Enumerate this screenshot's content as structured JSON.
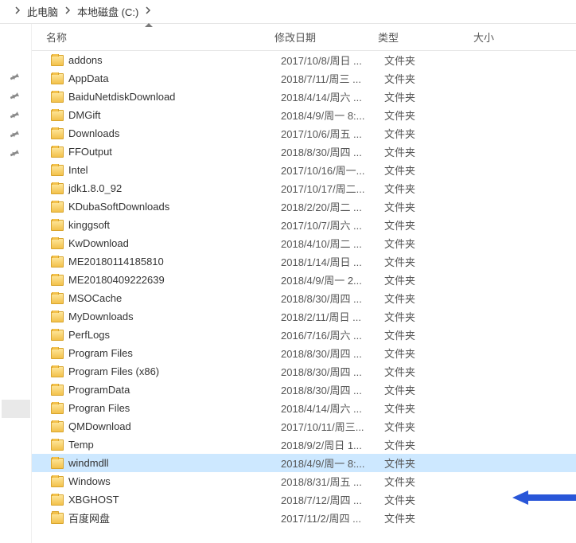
{
  "breadcrumb": {
    "items": [
      "此电脑",
      "本地磁盘 (C:)"
    ]
  },
  "columns": {
    "name": "名称",
    "date": "修改日期",
    "type": "类型",
    "size": "大小"
  },
  "type_folder": "文件夹",
  "selected_index": 22,
  "rows": [
    {
      "name": "addons",
      "date": "2017/10/8/周日 ..."
    },
    {
      "name": "AppData",
      "date": "2018/7/11/周三 ..."
    },
    {
      "name": "BaiduNetdiskDownload",
      "date": "2018/4/14/周六 ..."
    },
    {
      "name": "DMGift",
      "date": "2018/4/9/周一 8:..."
    },
    {
      "name": "Downloads",
      "date": "2017/10/6/周五 ..."
    },
    {
      "name": "FFOutput",
      "date": "2018/8/30/周四 ..."
    },
    {
      "name": "Intel",
      "date": "2017/10/16/周一..."
    },
    {
      "name": "jdk1.8.0_92",
      "date": "2017/10/17/周二..."
    },
    {
      "name": "KDubaSoftDownloads",
      "date": "2018/2/20/周二 ..."
    },
    {
      "name": "kinggsoft",
      "date": "2017/10/7/周六 ..."
    },
    {
      "name": "KwDownload",
      "date": "2018/4/10/周二 ..."
    },
    {
      "name": "ME20180114185810",
      "date": "2018/1/14/周日 ..."
    },
    {
      "name": "ME20180409222639",
      "date": "2018/4/9/周一 2..."
    },
    {
      "name": "MSOCache",
      "date": "2018/8/30/周四 ..."
    },
    {
      "name": "MyDownloads",
      "date": "2018/2/11/周日 ..."
    },
    {
      "name": "PerfLogs",
      "date": "2016/7/16/周六 ..."
    },
    {
      "name": "Program Files",
      "date": "2018/8/30/周四 ..."
    },
    {
      "name": "Program Files (x86)",
      "date": "2018/8/30/周四 ..."
    },
    {
      "name": "ProgramData",
      "date": "2018/8/30/周四 ..."
    },
    {
      "name": "Progran Files",
      "date": "2018/4/14/周六 ..."
    },
    {
      "name": "QMDownload",
      "date": "2017/10/11/周三..."
    },
    {
      "name": "Temp",
      "date": "2018/9/2/周日 1..."
    },
    {
      "name": "windmdll",
      "date": "2018/4/9/周一 8:..."
    },
    {
      "name": "Windows",
      "date": "2018/8/31/周五 ..."
    },
    {
      "name": "XBGHOST",
      "date": "2018/7/12/周四 ..."
    },
    {
      "name": "百度网盘",
      "date": "2017/11/2/周四 ..."
    }
  ],
  "quick_pins": 5
}
